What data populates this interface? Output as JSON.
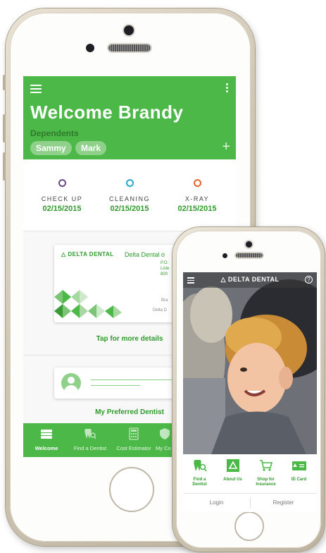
{
  "main_app": {
    "header": {
      "title": "Welcome Brandy",
      "dependents_label": "Dependents",
      "dependents": [
        "Sammy",
        "Mark"
      ],
      "add_icon": "plus-icon"
    },
    "appointments": [
      {
        "label": "CHECK UP",
        "date": "02/15/2015",
        "color": "#6a4a8a"
      },
      {
        "label": "CLEANING",
        "date": "02/15/2015",
        "color": "#29a9c9"
      },
      {
        "label": "X-RAY",
        "date": "02/15/2015",
        "color": "#e8642a"
      }
    ],
    "id_card": {
      "brand": "DELTA DENTAL",
      "title": "Delta Dental o",
      "address_lines": [
        "P.O.",
        "Lisle",
        "800"
      ],
      "member_name": "Bra",
      "member_sub": "Delta D",
      "link": "Tap for more details"
    },
    "preferred_dentist": {
      "link": "My Preferred Dentist"
    },
    "tabs": [
      {
        "label": "Welcome",
        "icon": "wallet-icon",
        "active": true
      },
      {
        "label": "Find a Dentist",
        "icon": "tooth-search-icon",
        "active": false
      },
      {
        "label": "Cost Estimator",
        "icon": "calculator-icon",
        "active": false
      },
      {
        "label": "My Co",
        "icon": "shield-icon",
        "active": false
      }
    ],
    "colors": {
      "brand_green": "#4cb848",
      "dark_green": "#2f9a2b",
      "chip_green": "#8fd18b"
    }
  },
  "second_app": {
    "brand": "DELTA DENTAL",
    "help_glyph": "?",
    "grid": [
      {
        "label_lines": [
          "Find a",
          "Dentist"
        ],
        "icon": "tooth-search-icon"
      },
      {
        "label_lines": [
          "About Us"
        ],
        "icon": "delta-logo-icon"
      },
      {
        "label_lines": [
          "Shop for",
          "Insurance"
        ],
        "icon": "cart-icon"
      },
      {
        "label_lines": [
          "ID Card"
        ],
        "icon": "id-card-icon"
      }
    ],
    "auth": {
      "login": "Login",
      "register": "Register"
    }
  }
}
